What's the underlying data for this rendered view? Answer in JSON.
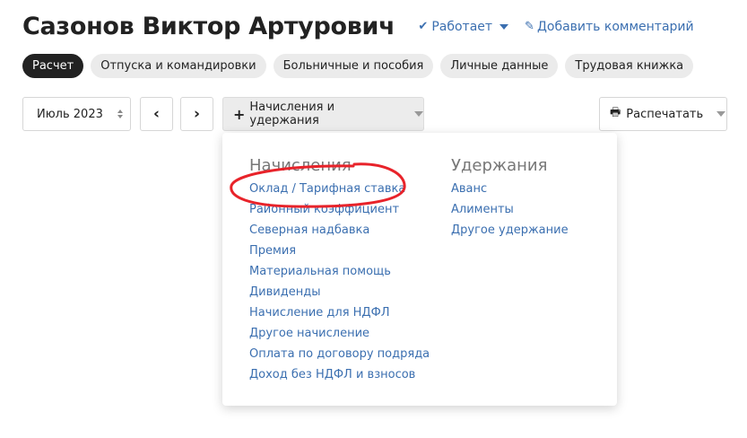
{
  "header": {
    "name": "Сазонов Виктор Артурович",
    "status": "Работает",
    "add_comment": "Добавить комментарий"
  },
  "tabs": [
    {
      "label": "Расчет",
      "active": true
    },
    {
      "label": "Отпуска и командировки"
    },
    {
      "label": "Больничные и пособия"
    },
    {
      "label": "Личные данные"
    },
    {
      "label": "Трудовая книжка"
    }
  ],
  "toolbar": {
    "month": "Июль 2023",
    "prev": "‹",
    "next": "›",
    "accruals_button": "Начисления и удержания",
    "print_button": "Распечатать"
  },
  "dropdown": {
    "accruals_title": "Начисления",
    "accruals": [
      "Оклад / Тарифная ставка",
      "Районный коэффициент",
      "Северная надбавка",
      "Премия",
      "Материальная помощь",
      "Дивиденды",
      "Начисление для НДФЛ",
      "Другое начисление",
      "Оплата по договору подряда",
      "Доход без НДФЛ и взносов"
    ],
    "deductions_title": "Удержания",
    "deductions": [
      "Аванс",
      "Алименты",
      "Другое удержание"
    ]
  },
  "colors": {
    "link": "#3b6fb0",
    "annotation": "#e8232a",
    "active_tab": "#222222"
  }
}
